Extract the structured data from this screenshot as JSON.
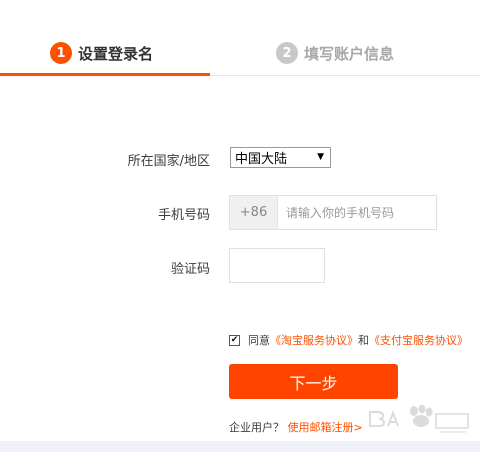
{
  "steps": [
    {
      "num": "1",
      "label": "设置登录名"
    },
    {
      "num": "2",
      "label": "填写账户信息"
    }
  ],
  "form": {
    "country_label": "所在国家/地区",
    "country_value": "中国大陆",
    "phone_label": "手机号码",
    "phone_prefix": "+86",
    "phone_placeholder": "请输入你的手机号码",
    "code_label": "验证码"
  },
  "agreement": {
    "prefix": "同意",
    "taobao_link": "《淘宝服务协议》",
    "and": "和",
    "alipay_link": "《支付宝服务协议》"
  },
  "next_button": "下一步",
  "enterprise": {
    "text": "企业用户？",
    "link": "使用邮箱注册>"
  },
  "colors": {
    "accent": "#ff5000",
    "button": "#ff4400",
    "inactive": "#c8c8c8"
  }
}
